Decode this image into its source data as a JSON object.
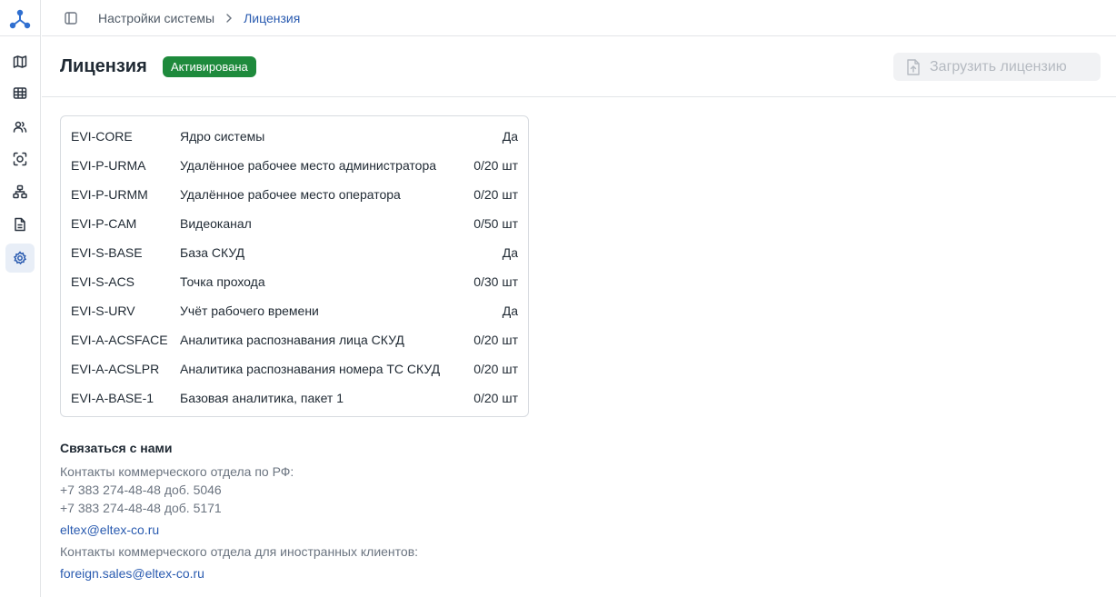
{
  "rail": {
    "items": [
      {
        "icon": "map-icon",
        "active": false
      },
      {
        "icon": "video-wall-icon",
        "active": false
      },
      {
        "icon": "users-icon",
        "active": false
      },
      {
        "icon": "face-scan-icon",
        "active": false
      },
      {
        "icon": "hierarchy-icon",
        "active": false
      },
      {
        "icon": "document-icon",
        "active": false
      },
      {
        "icon": "settings-icon",
        "active": true
      }
    ]
  },
  "breadcrumb": {
    "parent": "Настройки системы",
    "current": "Лицензия"
  },
  "header": {
    "title": "Лицензия",
    "status": "Активирована",
    "upload_label": "Загрузить лицензию"
  },
  "licenses": [
    {
      "code": "EVI-CORE",
      "name": "Ядро системы",
      "value": "Да"
    },
    {
      "code": "EVI-P-URMA",
      "name": "Удалённое рабочее место администратора",
      "value": "0/20 шт"
    },
    {
      "code": "EVI-P-URMM",
      "name": "Удалённое рабочее место оператора",
      "value": "0/20 шт"
    },
    {
      "code": "EVI-P-CAM",
      "name": "Видеоканал",
      "value": "0/50 шт"
    },
    {
      "code": "EVI-S-BASE",
      "name": "База СКУД",
      "value": "Да"
    },
    {
      "code": "EVI-S-ACS",
      "name": "Точка прохода",
      "value": "0/30 шт"
    },
    {
      "code": "EVI-S-URV",
      "name": "Учёт рабочего времени",
      "value": "Да"
    },
    {
      "code": "EVI-A-ACSFACE",
      "name": "Аналитика распознавания лица СКУД",
      "value": "0/20 шт"
    },
    {
      "code": "EVI-A-ACSLPR",
      "name": "Аналитика распознавания номера ТС СКУД",
      "value": "0/20 шт"
    },
    {
      "code": "EVI-A-BASE-1",
      "name": "Базовая аналитика, пакет 1",
      "value": "0/20 шт"
    }
  ],
  "contacts": {
    "heading": "Связаться с нами",
    "ru_label": "Контакты коммерческого отдела по РФ:",
    "ru_phone_1": "+7 383 274-48-48 доб. 5046",
    "ru_phone_2": "+7 383 274-48-48 доб. 5171",
    "ru_email": "eltex@eltex-co.ru",
    "foreign_label": "Контакты коммерческого отдела для иностранных клиентов:",
    "foreign_email": "foreign.sales@eltex-co.ru"
  },
  "colors": {
    "accent": "#2a5bb0",
    "badge": "#1e8a3c",
    "rail_icon": "#2b3440"
  }
}
